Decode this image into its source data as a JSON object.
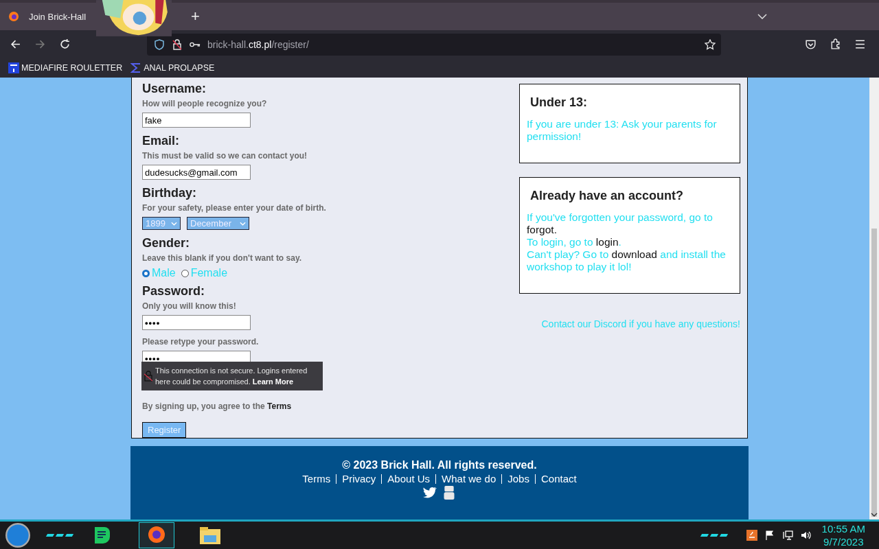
{
  "browser": {
    "tab_title": "Join Brick-Hall",
    "new_tab": "+",
    "url": {
      "host_start": "brick-hall.",
      "domain": "ct8.pl",
      "path": "/register/"
    },
    "bookmarks": [
      {
        "label": "MEDIAFIRE ROULETTER",
        "kind": "square"
      },
      {
        "label": "ANAL PROLAPSE",
        "kind": "sigma"
      }
    ]
  },
  "form": {
    "username": {
      "label": "Username:",
      "hint": "How will people recognize you?",
      "value": "fake"
    },
    "email": {
      "label": "Email:",
      "hint": "This must be valid so we can contact you!",
      "value": "dudesucks@gmail.com"
    },
    "birthday": {
      "label": "Birthday:",
      "hint": "For your safety, please enter your date of birth.",
      "selects": [
        "1899",
        "December"
      ]
    },
    "gender": {
      "label": "Gender:",
      "hint": "Leave this blank if you don't want to say.",
      "options": [
        {
          "label": "Male",
          "selected": true
        },
        {
          "label": "Female",
          "selected": false
        }
      ]
    },
    "password": {
      "label": "Password:",
      "hint": "Only you will know this!",
      "value": "••••",
      "retype_hint": "Please retype your password.",
      "retype_value": "••••"
    },
    "tooltip": {
      "text": "This connection is not secure. Logins entered here could be compromised.",
      "link": "Learn More"
    },
    "agreement": "By signing up, you agree to the **Terms**",
    "register_button": "Register"
  },
  "side": {
    "boxes": [
      {
        "title": "Under 13:",
        "paragraphs": [
          [
            {
              "text": "If you are under 13: Ask your parents for permission!",
              "kind": "plain"
            }
          ]
        ]
      },
      {
        "title": "Already have an account?",
        "paragraphs": [
          [
            {
              "text": "If you've forgotten your password, go to ",
              "kind": "plain"
            },
            {
              "text": "forgot",
              "kind": "link"
            },
            {
              "text": ".",
              "kind": "dark"
            }
          ],
          [
            {
              "text": "To login, go to ",
              "kind": "plain"
            },
            {
              "text": "login",
              "kind": "link"
            },
            {
              "text": ".",
              "kind": "plain"
            }
          ],
          [
            {
              "text": "Can't play? Go to ",
              "kind": "plain"
            },
            {
              "text": "download",
              "kind": "link"
            },
            {
              "text": " and install the workshop to play it lol!",
              "kind": "plain"
            }
          ]
        ]
      }
    ],
    "contact": "Contact our Discord if you have any questions!"
  },
  "footer": {
    "copyright": "© 2023 Brick Hall. All rights reserved.",
    "links": [
      "Terms",
      "Privacy",
      "About Us",
      "What we do",
      "Jobs",
      "Contact"
    ]
  },
  "taskbar": {
    "time": "10:55 AM",
    "date": "9/7/2023"
  }
}
